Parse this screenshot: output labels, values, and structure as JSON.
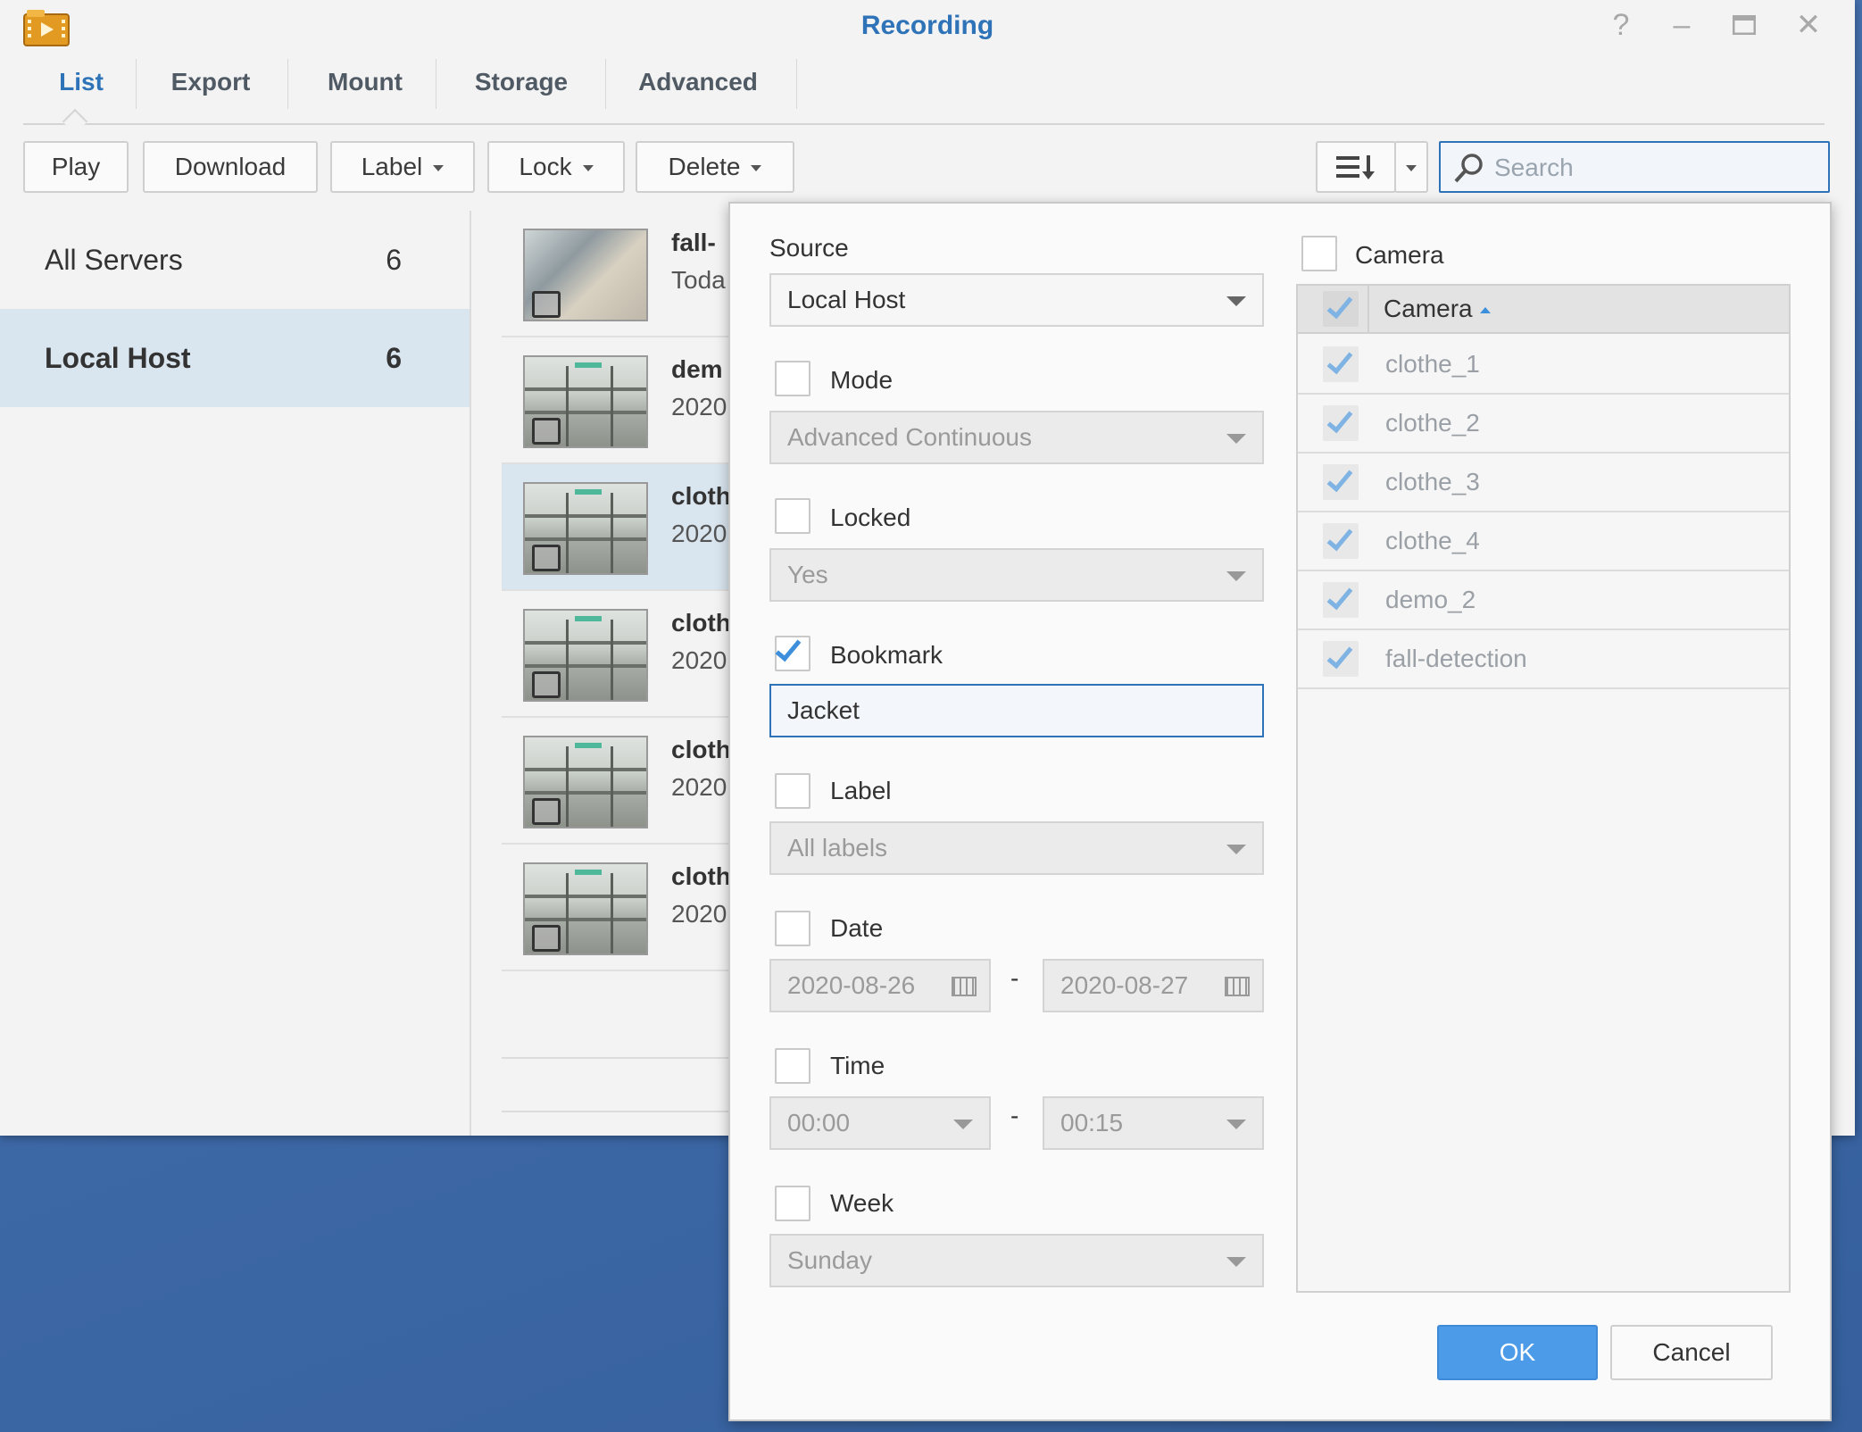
{
  "window": {
    "title": "Recording"
  },
  "tabs": [
    {
      "label": "List"
    },
    {
      "label": "Export"
    },
    {
      "label": "Mount"
    },
    {
      "label": "Storage"
    },
    {
      "label": "Advanced"
    }
  ],
  "toolbar": {
    "play": "Play",
    "download": "Download",
    "label": "Label",
    "lock": "Lock",
    "delete": "Delete",
    "search_placeholder": "Search"
  },
  "sidebar": {
    "items": [
      {
        "label": "All Servers",
        "count": "6"
      },
      {
        "label": "Local Host",
        "count": "6"
      }
    ]
  },
  "recordings": [
    {
      "title": "fall-",
      "sub": "Toda"
    },
    {
      "title": "dem",
      "sub": "2020"
    },
    {
      "title": "cloth",
      "sub": "2020"
    },
    {
      "title": "cloth",
      "sub": "2020"
    },
    {
      "title": "cloth",
      "sub": "2020"
    },
    {
      "title": "cloth",
      "sub": "2020"
    }
  ],
  "filter": {
    "source_label": "Source",
    "source_value": "Local Host",
    "mode_label": "Mode",
    "mode_value": "Advanced Continuous",
    "locked_label": "Locked",
    "locked_value": "Yes",
    "bookmark_label": "Bookmark",
    "bookmark_value": "Jacket",
    "label_label": "Label",
    "label_value": "All labels",
    "date_label": "Date",
    "date_from": "2020-08-26",
    "date_to": "2020-08-27",
    "time_label": "Time",
    "time_from": "00:00",
    "time_to": "00:15",
    "week_label": "Week",
    "week_value": "Sunday",
    "range_sep": "-",
    "camera_label": "Camera",
    "camera_header": "Camera",
    "cameras": [
      "clothe_1",
      "clothe_2",
      "clothe_3",
      "clothe_4",
      "demo_2",
      "fall-detection"
    ],
    "ok": "OK",
    "cancel": "Cancel"
  },
  "colors": {
    "accent": "#2e73b8",
    "selected_row": "#d9e5ef",
    "ok_button": "#4c9be8"
  }
}
